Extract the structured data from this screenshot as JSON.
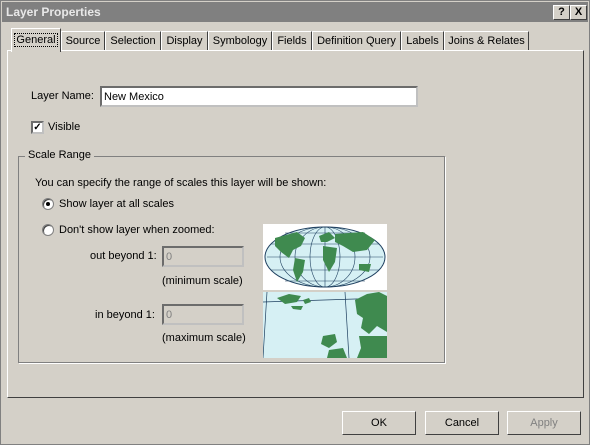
{
  "window": {
    "title": "Layer Properties"
  },
  "titlebar_buttons": {
    "help": "?",
    "close": "X"
  },
  "tabs": [
    {
      "label": "General",
      "active": true
    },
    {
      "label": "Source"
    },
    {
      "label": "Selection"
    },
    {
      "label": "Display"
    },
    {
      "label": "Symbology"
    },
    {
      "label": "Fields"
    },
    {
      "label": "Definition Query"
    },
    {
      "label": "Labels"
    },
    {
      "label": "Joins & Relates"
    }
  ],
  "general": {
    "layer_name_label": "Layer Name:",
    "layer_name_value": "New Mexico",
    "visible_label": "Visible",
    "visible_checked": true
  },
  "scale_range": {
    "title": "Scale Range",
    "description": "You can specify the range of scales this layer will be shown:",
    "option_all": "Show layer at all scales",
    "option_zoomed": "Don't show layer when zoomed:",
    "selected_option": "all",
    "out_beyond_label": "out beyond  1:",
    "out_beyond_value": "0",
    "min_scale_note": "(minimum scale)",
    "in_beyond_label": "in beyond  1:",
    "in_beyond_value": "0",
    "max_scale_note": "(maximum scale)"
  },
  "preview_images": {
    "world_icon": "world-map-icon",
    "zoomed_icon": "zoomed-coast-map-icon"
  },
  "colors": {
    "ocean": "#d6f0f4",
    "land": "#3f8a4f",
    "grid": "#1f4060"
  },
  "buttons": {
    "ok": "OK",
    "cancel": "Cancel",
    "apply": "Apply"
  }
}
